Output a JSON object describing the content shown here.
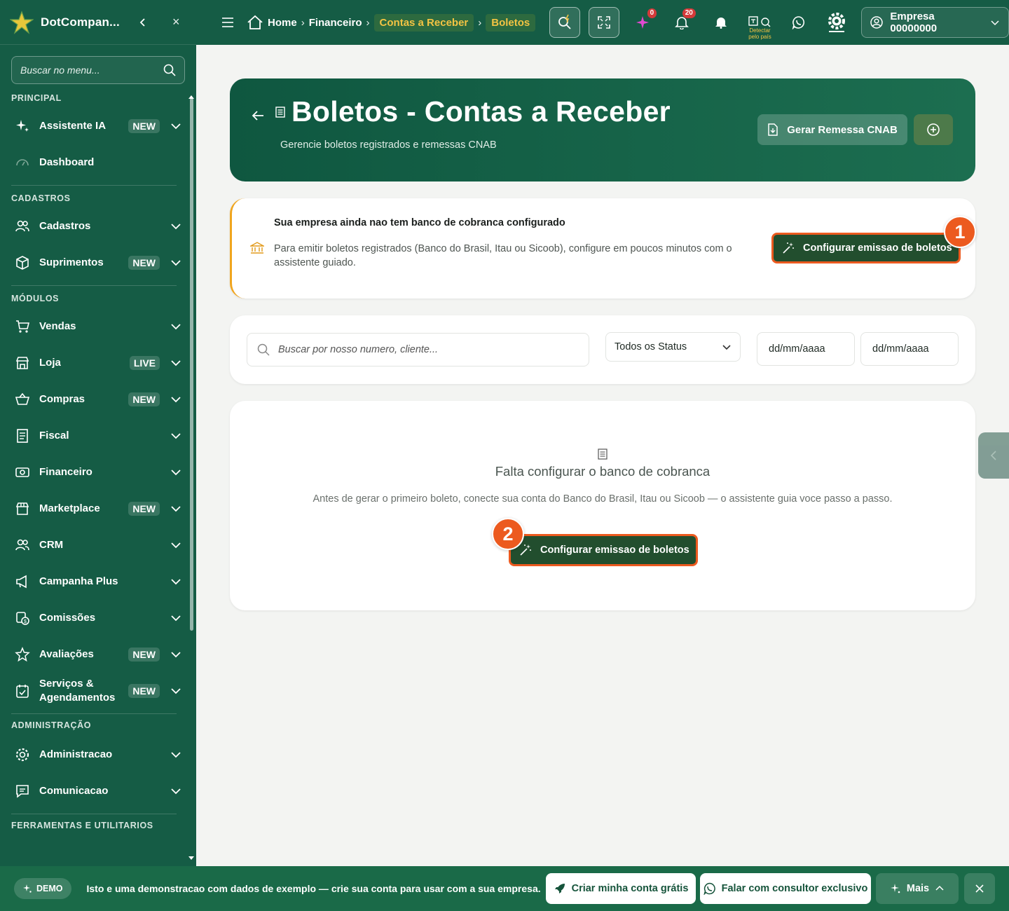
{
  "app": {
    "brand": "DotCompan..."
  },
  "sidebar": {
    "search_placeholder": "Buscar no menu...",
    "sections": {
      "principal": "PRINCIPAL",
      "cadastros": "CADASTROS",
      "modulos": "MÓDULOS",
      "administracao": "ADMINISTRAÇÃO",
      "ferramentas": "FERRAMENTAS E UTILITARIOS"
    },
    "items": [
      {
        "label": "Assistente IA",
        "badge": "NEW",
        "icon": "sparkle-icon"
      },
      {
        "label": "Dashboard",
        "badge": "",
        "icon": "gauge-icon"
      },
      {
        "label": "Cadastros",
        "badge": "",
        "icon": "users-icon"
      },
      {
        "label": "Suprimentos",
        "badge": "NEW",
        "icon": "box-icon"
      },
      {
        "label": "Vendas",
        "badge": "",
        "icon": "cart-icon"
      },
      {
        "label": "Loja",
        "badge": "LIVE",
        "icon": "store-icon"
      },
      {
        "label": "Compras",
        "badge": "NEW",
        "icon": "basket-icon"
      },
      {
        "label": "Fiscal",
        "badge": "",
        "icon": "receipt-icon"
      },
      {
        "label": "Financeiro",
        "badge": "",
        "icon": "money-icon"
      },
      {
        "label": "Marketplace",
        "badge": "NEW",
        "icon": "market-icon"
      },
      {
        "label": "CRM",
        "badge": "",
        "icon": "users-icon"
      },
      {
        "label": "Campanha Plus",
        "badge": "",
        "icon": "megaphone-icon"
      },
      {
        "label": "Comissões",
        "badge": "",
        "icon": "commission-icon"
      },
      {
        "label": "Avaliações",
        "badge": "NEW",
        "icon": "star-icon"
      },
      {
        "label": "Serviços & Agendamentos",
        "badge": "NEW",
        "icon": "calendar-check-icon"
      },
      {
        "label": "Administracao",
        "badge": "",
        "icon": "gear-icon"
      },
      {
        "label": "Comunicacao",
        "badge": "",
        "icon": "chat-icon"
      }
    ]
  },
  "topbar": {
    "breadcrumbs": [
      "Home",
      "Financeiro",
      "Contas a Receber",
      "Boletos"
    ],
    "notif_ai": "0",
    "notif_bell": "20",
    "detect_label": "Detectar pelo país",
    "company": "Empresa 00000000"
  },
  "hero": {
    "title": "Boletos - Contas a Receber",
    "subtitle": "Gerencie boletos registrados e remessas CNAB",
    "cnab_button": "Gerar Remessa CNAB"
  },
  "alert": {
    "title": "Sua empresa ainda nao tem banco de cobranca configurado",
    "text": "Para emitir boletos registrados (Banco do Brasil, Itau ou Sicoob), configure em poucos minutos com o assistente guiado.",
    "button": "Configurar emissao de boletos",
    "step": "1"
  },
  "filters": {
    "search_placeholder": "Buscar por nosso numero, cliente...",
    "status": "Todos os Status",
    "date_from": "dd/mm/aaaa",
    "date_to": "dd/mm/aaaa"
  },
  "empty": {
    "title": "Falta configurar o banco de cobranca",
    "text": "Antes de gerar o primeiro boleto, conecte sua conta do Banco do Brasil, Itau ou Sicoob — o assistente guia voce passo a passo.",
    "button": "Configurar emissao de boletos",
    "step": "2"
  },
  "bottom": {
    "demo": "DEMO",
    "text": "Isto e uma demonstracao com dados de exemplo — crie sua conta para usar com a sua empresa.",
    "create": "Criar minha conta grátis",
    "consultant": "Falar com consultor exclusivo",
    "more": "Mais"
  },
  "colors": {
    "primary": "#155c45",
    "accent": "#ec5a1f",
    "highlight": "#f3c343"
  }
}
